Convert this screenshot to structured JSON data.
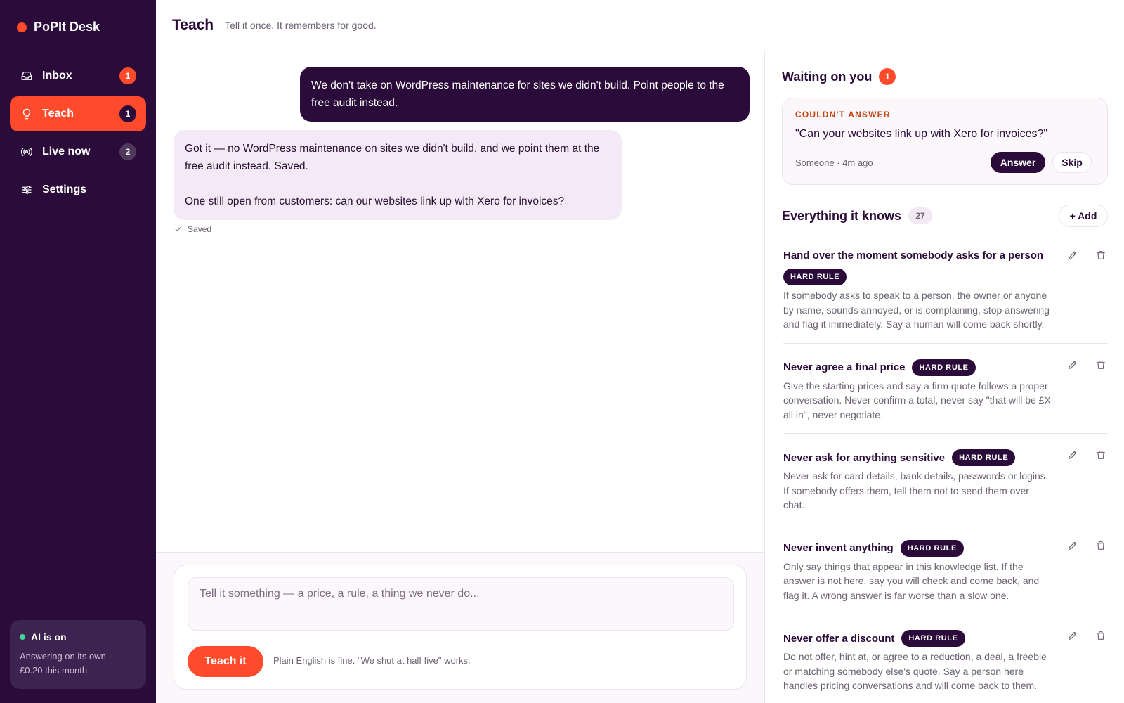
{
  "app": {
    "name": "PoPIt Desk",
    "brand_color": "#ff4a2b"
  },
  "sidebar": {
    "items": [
      {
        "label": "Inbox",
        "icon": "inbox-icon",
        "badge": "1"
      },
      {
        "label": "Teach",
        "icon": "lightbulb-icon",
        "badge": "1",
        "active": true
      },
      {
        "label": "Live now",
        "icon": "broadcast-icon",
        "badge": "2"
      },
      {
        "label": "Settings",
        "icon": "sliders-icon"
      }
    ],
    "ai_status": {
      "title": "AI is on",
      "subtitle": "Answering on its own ·",
      "cost": "£0.20 this month"
    }
  },
  "header": {
    "title": "Teach",
    "subtitle": "Tell it once. It remembers for good."
  },
  "chat": {
    "user_message": "We don't take on WordPress maintenance for sites we didn't build. Point people to the free audit instead.",
    "bot_message_1": "Got it — no WordPress maintenance on sites we didn't build, and we point them at the free audit instead. Saved.",
    "bot_message_2": "One still open from customers: can our websites link up with Xero for invoices?",
    "saved_label": "Saved"
  },
  "composer": {
    "placeholder": "Tell it something — a price, a rule, a thing we never do...",
    "button_label": "Teach it",
    "hint": "Plain English is fine. \"We shut at half five\" works."
  },
  "waiting": {
    "title": "Waiting on you",
    "count": "1",
    "card": {
      "label": "COULDN'T ANSWER",
      "question": "\"Can your websites link up with Xero for invoices?\"",
      "meta": "Someone · 4m ago",
      "answer_label": "Answer",
      "skip_label": "Skip"
    }
  },
  "knowledge": {
    "title": "Everything it knows",
    "count": "27",
    "add_label": "+ Add",
    "rules": [
      {
        "title": "Hand over the moment somebody asks for a person",
        "tag": "HARD RULE",
        "description": "If somebody asks to speak to a person, the owner or anyone by name, sounds annoyed, or is complaining, stop answering and flag it immediately. Say a human will come back shortly."
      },
      {
        "title": "Never agree a final price",
        "tag": "HARD RULE",
        "description": "Give the starting prices and say a firm quote follows a proper conversation. Never confirm a total, never say \"that will be £X all in\", never negotiate."
      },
      {
        "title": "Never ask for anything sensitive",
        "tag": "HARD RULE",
        "description": "Never ask for card details, bank details, passwords or logins. If somebody offers them, tell them not to send them over chat."
      },
      {
        "title": "Never invent anything",
        "tag": "HARD RULE",
        "description": "Only say things that appear in this knowledge list. If the answer is not here, say you will check and come back, and flag it. A wrong answer is far worse than a slow one."
      },
      {
        "title": "Never offer a discount",
        "tag": "HARD RULE",
        "description": "Do not offer, hint at, or agree to a reduction, a deal, a freebie or matching somebody else's quote. Say a person here handles pricing conversations and will come back to them."
      }
    ]
  }
}
